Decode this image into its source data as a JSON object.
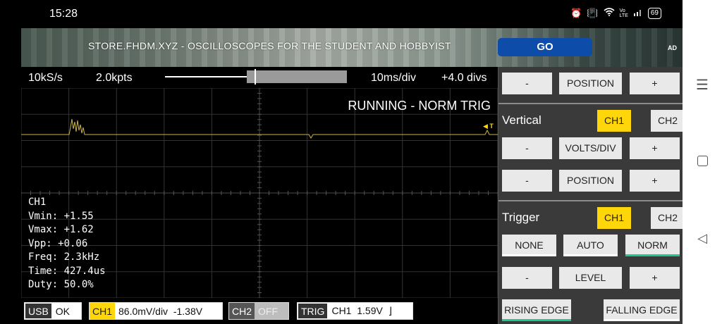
{
  "status_bar": {
    "time": "15:28",
    "icons": [
      "alarm-icon",
      "vibrate-icon",
      "wifi-icon",
      "volte-icon",
      "signal-icon"
    ],
    "battery": "69"
  },
  "ad": {
    "text": "STORE.FHDM.XYZ - OSCILLOSCOPES FOR THE STUDENT AND HOBBYIST",
    "button": "GO",
    "tag": "AD"
  },
  "scope_top": {
    "sample_rate": "10kS/s",
    "points": "2.0kpts",
    "time_div": "10ms/div",
    "delay": "+4.0 divs"
  },
  "scope": {
    "run_status": "RUNNING - NORM TRIG",
    "trigger_marker": "◀ T",
    "trace_color": "#c8b44a",
    "accent": "#ffd60a"
  },
  "measurements": {
    "channel": "CH1",
    "lines": [
      "Vmin: +1.55",
      "Vmax: +1.62",
      "Vpp: +0.06",
      "Freq: 2.3kHz",
      "Time: 427.4us",
      "Duty: 50.0%"
    ]
  },
  "bottom_bar": {
    "usb_tag": "USB",
    "usb_value": "OK",
    "ch1_tag": "CH1",
    "ch1_value": "86.0mV/div  -1.38V",
    "ch2_tag": "CH2",
    "ch2_value": "OFF",
    "trig_tag": "TRIG",
    "trig_value": "CH1  1.59V  ⌋"
  },
  "panel": {
    "horizontal": {
      "minus": "-",
      "position": "POSITION",
      "plus": "+"
    },
    "vertical": {
      "label": "Vertical",
      "ch1": "CH1",
      "ch2": "CH2",
      "minus1": "-",
      "volts_div": "VOLTS/DIV",
      "plus1": "+",
      "minus2": "-",
      "position": "POSITION",
      "plus2": "+"
    },
    "trigger": {
      "label": "Trigger",
      "ch1": "CH1",
      "ch2": "CH2",
      "none": "NONE",
      "auto": "AUTO",
      "norm": "NORM",
      "minus": "-",
      "level": "LEVEL",
      "plus": "+",
      "rising": "RISING EDGE",
      "falling": "FALLING EDGE"
    }
  },
  "navbar": {
    "menu": "☰",
    "back": "◁"
  }
}
